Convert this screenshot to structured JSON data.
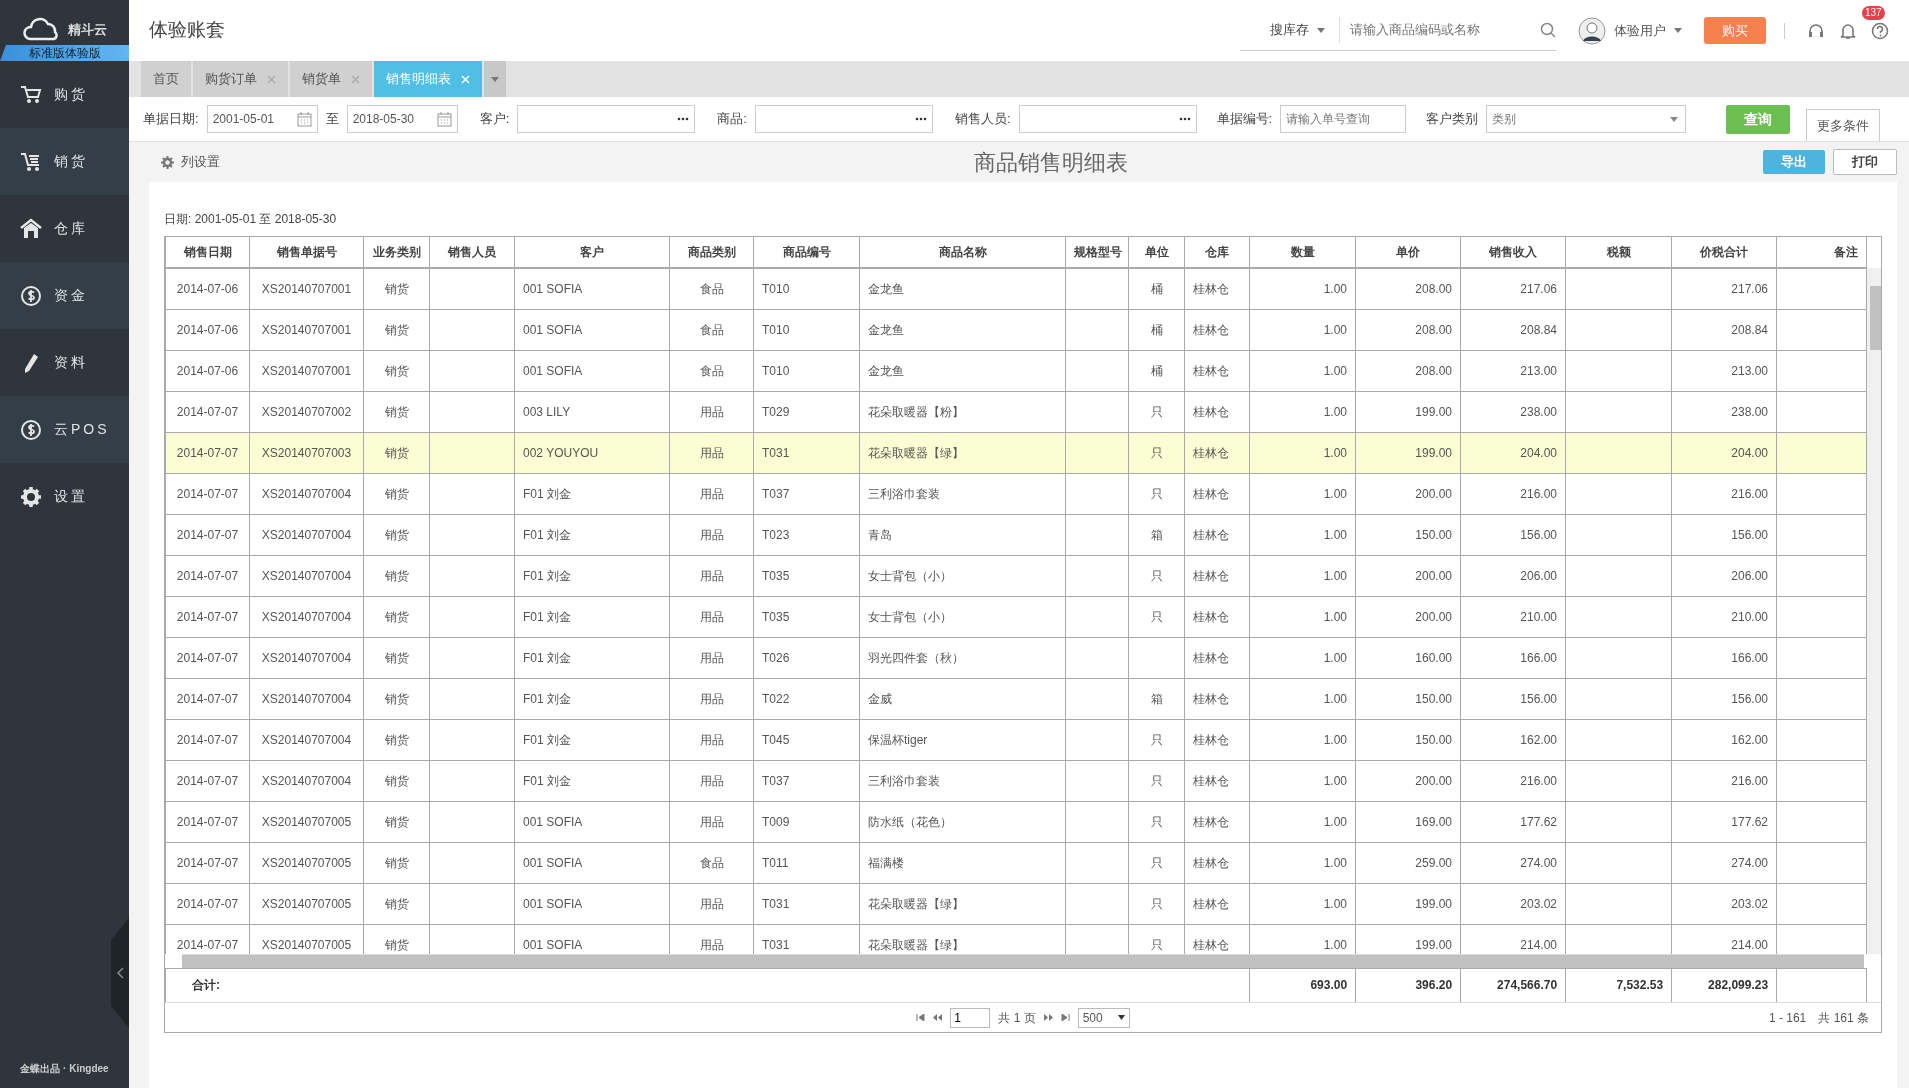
{
  "brand": {
    "name": "精斗云",
    "edition": "标准版体验版"
  },
  "sidebar": {
    "items": [
      {
        "label": "购货"
      },
      {
        "label": "销货"
      },
      {
        "label": "仓库"
      },
      {
        "label": "资金"
      },
      {
        "label": "资料"
      },
      {
        "label": "云POS"
      },
      {
        "label": "设置"
      }
    ],
    "footer": "金蝶出品 · Kingdee"
  },
  "header": {
    "title": "体验账套",
    "search_scope": "搜库存",
    "search": {
      "placeholder": "请输入商品编码或名称"
    },
    "user": "体验用户",
    "buy_button": "购买",
    "notifications": "137"
  },
  "tabs": [
    {
      "label": "首页",
      "closable": false,
      "selected": false
    },
    {
      "label": "购货订单",
      "closable": true,
      "selected": false
    },
    {
      "label": "销货单",
      "closable": true,
      "selected": false
    },
    {
      "label": "销售明细表",
      "closable": true,
      "selected": true
    }
  ],
  "filters": {
    "date_label": "单据日期:",
    "date_from": "2001-05-01",
    "date_sep": "至",
    "date_to": "2018-05-30",
    "customer_label": "客户:",
    "product_label": "商品:",
    "staff_label": "销售人员:",
    "number_label": "单据编号:",
    "number_placeholder": "请输入单号查询",
    "category_label": "客户类别",
    "category_placeholder": "类别",
    "query_button": "查询",
    "more_tab": "更多条件"
  },
  "toolbar": {
    "column_settings": "列设置",
    "title": "商品销售明细表",
    "export_button": "导出",
    "print_button": "打印"
  },
  "date_range": "日期: 2001-05-01 至 2018-05-30",
  "table": {
    "columns": [
      "销售日期",
      "销售单据号",
      "业务类别",
      "销售人员",
      "客户",
      "商品类别",
      "商品编号",
      "商品名称",
      "规格型号",
      "单位",
      "仓库",
      "数量",
      "单价",
      "销售收入",
      "税额",
      "价税合计",
      "备注"
    ],
    "rows": [
      {
        "selected": false,
        "cells": [
          "2014-07-06",
          "XS20140707001",
          "销货",
          null,
          "001 SOFIA",
          "食品",
          "T010",
          "金龙鱼",
          null,
          "桶",
          "桂林仓",
          "1.00",
          "208.00",
          "217.06",
          null,
          "217.06",
          null
        ]
      },
      {
        "selected": false,
        "cells": [
          "2014-07-06",
          "XS20140707001",
          "销货",
          null,
          "001 SOFIA",
          "食品",
          "T010",
          "金龙鱼",
          null,
          "桶",
          "桂林仓",
          "1.00",
          "208.00",
          "208.84",
          null,
          "208.84",
          null
        ]
      },
      {
        "selected": false,
        "cells": [
          "2014-07-06",
          "XS20140707001",
          "销货",
          null,
          "001 SOFIA",
          "食品",
          "T010",
          "金龙鱼",
          null,
          "桶",
          "桂林仓",
          "1.00",
          "208.00",
          "213.00",
          null,
          "213.00",
          null
        ]
      },
      {
        "selected": false,
        "cells": [
          "2014-07-07",
          "XS20140707002",
          "销货",
          null,
          "003 LILY",
          "用品",
          "T029",
          "花朵取暖器【粉】",
          null,
          "只",
          "桂林仓",
          "1.00",
          "199.00",
          "238.00",
          null,
          "238.00",
          null
        ]
      },
      {
        "selected": true,
        "cells": [
          "2014-07-07",
          "XS20140707003",
          "销货",
          null,
          "002 YOUYOU",
          "用品",
          "T031",
          "花朵取暖器【绿】",
          null,
          "只",
          "桂林仓",
          "1.00",
          "199.00",
          "204.00",
          null,
          "204.00",
          null
        ]
      },
      {
        "selected": false,
        "cells": [
          "2014-07-07",
          "XS20140707004",
          "销货",
          null,
          "F01 刘金",
          "用品",
          "T037",
          "三利浴巾套装",
          null,
          "只",
          "桂林仓",
          "1.00",
          "200.00",
          "216.00",
          null,
          "216.00",
          null
        ]
      },
      {
        "selected": false,
        "cells": [
          "2014-07-07",
          "XS20140707004",
          "销货",
          null,
          "F01 刘金",
          "用品",
          "T023",
          "青岛",
          null,
          "箱",
          "桂林仓",
          "1.00",
          "150.00",
          "156.00",
          null,
          "156.00",
          null
        ]
      },
      {
        "selected": false,
        "cells": [
          "2014-07-07",
          "XS20140707004",
          "销货",
          null,
          "F01 刘金",
          "用品",
          "T035",
          "女士背包（小）",
          null,
          "只",
          "桂林仓",
          "1.00",
          "200.00",
          "206.00",
          null,
          "206.00",
          null
        ]
      },
      {
        "selected": false,
        "cells": [
          "2014-07-07",
          "XS20140707004",
          "销货",
          null,
          "F01 刘金",
          "用品",
          "T035",
          "女士背包（小）",
          null,
          "只",
          "桂林仓",
          "1.00",
          "200.00",
          "210.00",
          null,
          "210.00",
          null
        ]
      },
      {
        "selected": false,
        "cells": [
          "2014-07-07",
          "XS20140707004",
          "销货",
          null,
          "F01 刘金",
          "用品",
          "T026",
          "羽光四件套（秋）",
          null,
          null,
          "桂林仓",
          "1.00",
          "160.00",
          "166.00",
          null,
          "166.00",
          null
        ]
      },
      {
        "selected": false,
        "cells": [
          "2014-07-07",
          "XS20140707004",
          "销货",
          null,
          "F01 刘金",
          "用品",
          "T022",
          "金威",
          null,
          "箱",
          "桂林仓",
          "1.00",
          "150.00",
          "156.00",
          null,
          "156.00",
          null
        ]
      },
      {
        "selected": false,
        "cells": [
          "2014-07-07",
          "XS20140707004",
          "销货",
          null,
          "F01 刘金",
          "用品",
          "T045",
          "保温杯tiger",
          null,
          "只",
          "桂林仓",
          "1.00",
          "150.00",
          "162.00",
          null,
          "162.00",
          null
        ]
      },
      {
        "selected": false,
        "cells": [
          "2014-07-07",
          "XS20140707004",
          "销货",
          null,
          "F01 刘金",
          "用品",
          "T037",
          "三利浴巾套装",
          null,
          "只",
          "桂林仓",
          "1.00",
          "200.00",
          "216.00",
          null,
          "216.00",
          null
        ]
      },
      {
        "selected": false,
        "cells": [
          "2014-07-07",
          "XS20140707005",
          "销货",
          null,
          "001 SOFIA",
          "用品",
          "T009",
          "防水纸（花色）",
          null,
          "只",
          "桂林仓",
          "1.00",
          "169.00",
          "177.62",
          null,
          "177.62",
          null
        ]
      },
      {
        "selected": false,
        "cells": [
          "2014-07-07",
          "XS20140707005",
          "销货",
          null,
          "001 SOFIA",
          "食品",
          "T011",
          "福满楼",
          null,
          "只",
          "桂林仓",
          "1.00",
          "259.00",
          "274.00",
          null,
          "274.00",
          null
        ]
      },
      {
        "selected": false,
        "cells": [
          "2014-07-07",
          "XS20140707005",
          "销货",
          null,
          "001 SOFIA",
          "用品",
          "T031",
          "花朵取暖器【绿】",
          null,
          "只",
          "桂林仓",
          "1.00",
          "199.00",
          "203.02",
          null,
          "203.02",
          null
        ]
      },
      {
        "selected": false,
        "cells": [
          "2014-07-07",
          "XS20140707005",
          "销货",
          null,
          "001 SOFIA",
          "用品",
          "T031",
          "花朵取暖器【绿】",
          null,
          "只",
          "桂林仓",
          "1.00",
          "199.00",
          "214.00",
          null,
          "214.00",
          null
        ]
      }
    ],
    "totals": {
      "label": "合计:",
      "values": [
        "693.00",
        "396.20",
        "274,566.70",
        "7,532.53",
        "282,099.23"
      ]
    }
  },
  "pager": {
    "page": "1",
    "pages": "共 1 页",
    "page_size": "500",
    "range": "1 - 161",
    "count": "共 161 条"
  }
}
